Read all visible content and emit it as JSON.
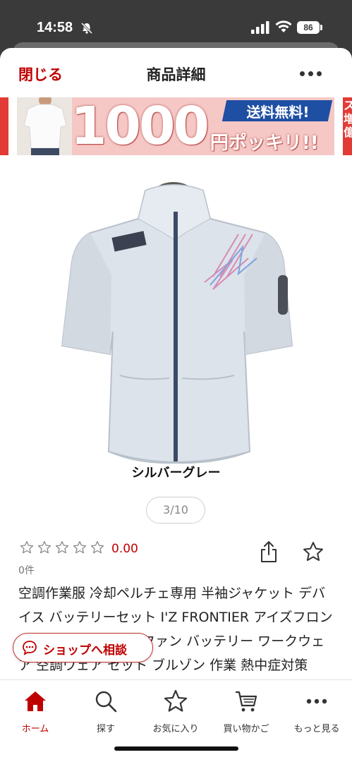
{
  "status_bar": {
    "time": "14:58",
    "battery": "86",
    "icons": [
      "bell-slash-icon",
      "signal-icon",
      "wifi-icon",
      "battery-icon"
    ]
  },
  "nav": {
    "close_label": "閉じる",
    "title": "商品詳細",
    "more_icon": "more-dots-icon"
  },
  "banner": {
    "big_text": "1000",
    "ribbon_text": "送料無料!",
    "sub_text": "円ポッキリ!!",
    "right_partial_text": "ス\n増\n億"
  },
  "product": {
    "color_caption": "シルバーグレー",
    "pager": "3/10",
    "rating_value": "0.00",
    "review_count": "0件",
    "title": "空調作業服 冷却ペルチェ専用 半袖ジャケット デバイス バッテリーセット I'Z FRONTIER アイズフロンティア ペルチェ6個 ファン バッテリー ワークウェア 空調ウェア セット ブルゾン 作業 熱中症対策",
    "stars": 5,
    "jacket_print": "I'Z FRONTIER SPORT"
  },
  "consult_button": {
    "label": "ショップへ相談"
  },
  "tabbar": {
    "tabs": [
      {
        "label": "ホーム",
        "icon": "home-icon",
        "active": true
      },
      {
        "label": "探す",
        "icon": "search-icon",
        "active": false
      },
      {
        "label": "お気に入り",
        "icon": "star-icon",
        "active": false
      },
      {
        "label": "買い物かご",
        "icon": "cart-icon",
        "active": false
      },
      {
        "label": "もっと見る",
        "icon": "more-dots-icon",
        "active": false
      }
    ]
  },
  "colors": {
    "brand_red": "#bf0000",
    "banner_pink": "#f5c8c6",
    "ribbon_blue": "#1e4fa3"
  }
}
